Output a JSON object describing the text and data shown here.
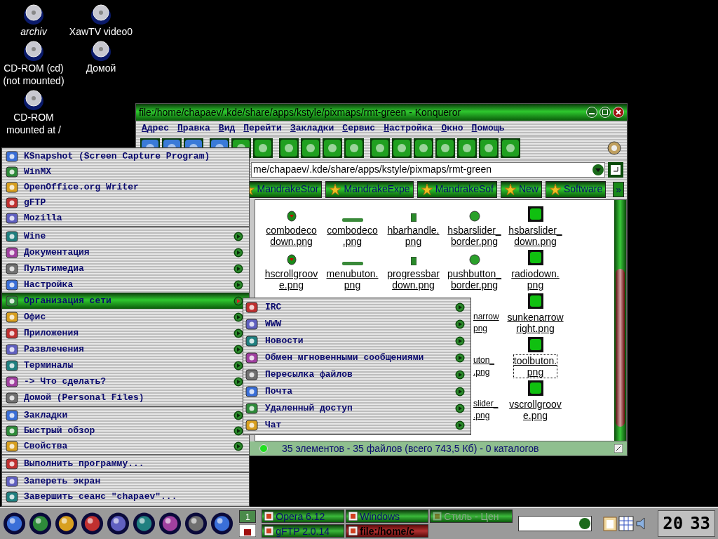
{
  "desktop_icons": [
    {
      "lines": [
        "archiv"
      ],
      "italic": true
    },
    {
      "lines": [
        "XawTV video0"
      ],
      "italic": false
    },
    {
      "lines": [
        "CD-ROM (cd)",
        "(not mounted)"
      ],
      "italic": false
    },
    {
      "lines": [
        "Домой"
      ],
      "italic": false
    },
    {
      "lines": [
        "CD-ROM",
        "mounted at /"
      ],
      "italic": false
    }
  ],
  "browser": {
    "title": "file:/home/chapaev/.kde/share/apps/kstyle/pixmaps/rmt-green - Konqueror",
    "menu": [
      "Адрес",
      "Правка",
      "Вид",
      "Перейти",
      "Закладки",
      "Сервис",
      "Настройка",
      "Окно",
      "Помощь"
    ],
    "location": "me/chapaev/.kde/share/apps/kstyle/pixmaps/rmt-green",
    "bookmarks": [
      {
        "label": "MandrakeStor"
      },
      {
        "label": "MandrakeExpe"
      },
      {
        "label": "MandrakeSof"
      },
      {
        "label": "New"
      },
      {
        "label": "Software"
      }
    ],
    "more_button": "»",
    "file_rows": [
      {
        "cells": [
          {
            "lines": [
              "combodeco",
              "down.png"
            ],
            "selected": false,
            "clipped": false
          },
          {
            "lines": [
              "combodeco",
              ".png"
            ],
            "selected": false,
            "clipped": false
          },
          {
            "lines": [
              "hbarhandle.",
              "png"
            ],
            "selected": false,
            "clipped": false
          },
          {
            "lines": [
              "hsbarslider_",
              "border.png"
            ],
            "selected": false,
            "clipped": false
          },
          {
            "lines": [
              "hsbarslider_",
              "down.png"
            ],
            "selected": false,
            "clipped": false
          }
        ]
      },
      {
        "cells": [
          {
            "lines": [
              "hscrollgroov",
              "e.png"
            ],
            "selected": false,
            "clipped": false
          },
          {
            "lines": [
              "menubuton.",
              "png"
            ],
            "selected": false,
            "clipped": false
          },
          {
            "lines": [
              "progressbar",
              "down.png"
            ],
            "selected": false,
            "clipped": false
          },
          {
            "lines": [
              "pushbutton_",
              "border.png"
            ],
            "selected": false,
            "clipped": false
          },
          {
            "lines": [
              "radiodown.",
              "png"
            ],
            "selected": false,
            "clipped": false
          }
        ]
      },
      {
        "cells": [
          {
            "lines": [
              "narrow",
              "png"
            ],
            "selected": false,
            "clipped": true
          },
          {
            "lines": [
              "sunkenarrow",
              "right.png"
            ],
            "selected": false,
            "clipped": false
          }
        ]
      },
      {
        "cells": [
          {
            "lines": [
              "uton_",
              ".png"
            ],
            "selected": false,
            "clipped": true
          },
          {
            "lines": [
              "toolbuton.",
              "png"
            ],
            "selected": true,
            "clipped": false
          }
        ]
      },
      {
        "cells": [
          {
            "lines": [
              "slider_",
              ".png"
            ],
            "selected": false,
            "clipped": true
          },
          {
            "lines": [
              "vscrollgroov",
              "e.png"
            ],
            "selected": false,
            "clipped": false
          }
        ]
      }
    ],
    "status": "35 элементов - 35 файлов (всего 743,5 Кб) - 0 каталогов"
  },
  "k_menu": {
    "sections": [
      [
        {
          "label": "KSnapshot (Screen Capture Program)",
          "submenu": false,
          "selected": false
        },
        {
          "label": "WinMX",
          "submenu": false,
          "selected": false
        },
        {
          "label": "OpenOffice.org Writer",
          "submenu": false,
          "selected": false
        },
        {
          "label": "gFTP",
          "submenu": false,
          "selected": false
        },
        {
          "label": "Mozilla",
          "submenu": false,
          "selected": false
        }
      ],
      [
        {
          "label": "Wine",
          "submenu": true,
          "selected": false
        },
        {
          "label": "Документация",
          "submenu": true,
          "selected": false
        },
        {
          "label": "Пультимедиа",
          "submenu": true,
          "selected": false
        },
        {
          "label": "Настройка",
          "submenu": true,
          "selected": false
        },
        {
          "label": "Организация сети",
          "submenu": true,
          "selected": true
        },
        {
          "label": "Офис",
          "submenu": true,
          "selected": false
        },
        {
          "label": "Приложения",
          "submenu": true,
          "selected": false
        },
        {
          "label": "Развлечения",
          "submenu": true,
          "selected": false
        },
        {
          "label": "Терминалы",
          "submenu": true,
          "selected": false
        },
        {
          "label": "-> Что сделать?",
          "submenu": true,
          "selected": false
        },
        {
          "label": "Домой (Personal Files)",
          "submenu": false,
          "selected": false
        }
      ],
      [
        {
          "label": "Закладки",
          "submenu": true,
          "selected": false
        },
        {
          "label": "Быстрый обзор",
          "submenu": true,
          "selected": false
        },
        {
          "label": "Свойства",
          "submenu": true,
          "selected": false
        }
      ],
      [
        {
          "label": "Выполнить программу...",
          "submenu": false,
          "selected": false
        }
      ],
      [
        {
          "label": "Запереть экран",
          "submenu": false,
          "selected": false
        },
        {
          "label": "Завершить сеанс \"chapaev\"...",
          "submenu": false,
          "selected": false
        }
      ]
    ]
  },
  "submenu": {
    "items": [
      {
        "label": "IRC",
        "submenu": true
      },
      {
        "label": "WWW",
        "submenu": true
      },
      {
        "label": "Новости",
        "submenu": true
      },
      {
        "label": "Обмен мгновенными сообщениями",
        "submenu": true
      },
      {
        "label": "Пересылка файлов",
        "submenu": true
      },
      {
        "label": "Почта",
        "submenu": true
      },
      {
        "label": "Удаленный доступ",
        "submenu": true
      },
      {
        "label": "Чат",
        "submenu": true
      }
    ]
  },
  "taskbar": {
    "pager": [
      {
        "label": "1",
        "selected": true
      }
    ],
    "tasks": [
      {
        "label": "Opera 6.12",
        "selected": false,
        "minimized": false
      },
      {
        "label": "Windows",
        "selected": false,
        "minimized": false
      },
      {
        "label": "Стиль - Цен",
        "selected": false,
        "minimized": true
      },
      {
        "label": "gFTP 2.0.14",
        "selected": false,
        "minimized": false
      },
      {
        "label": "file:/home/c",
        "selected": true,
        "minimized": false
      }
    ],
    "clock": {
      "hours": "20",
      "minutes": "33"
    }
  }
}
